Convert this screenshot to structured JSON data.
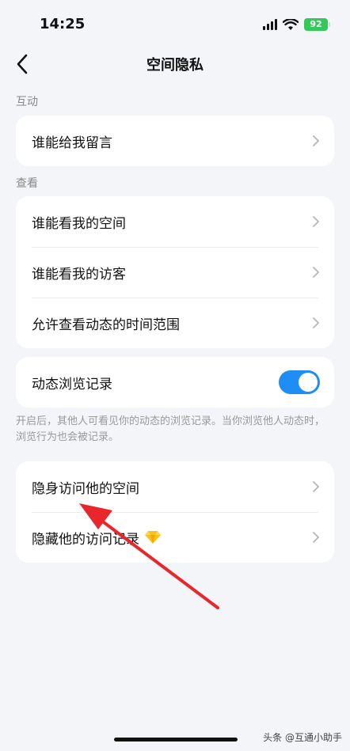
{
  "status_bar": {
    "time": "14:25",
    "battery": "92"
  },
  "nav": {
    "title": "空间隐私"
  },
  "sections": {
    "interaction": {
      "label": "互动",
      "items": [
        {
          "label": "谁能给我留言"
        }
      ]
    },
    "view": {
      "label": "查看",
      "items": [
        {
          "label": "谁能看我的空间"
        },
        {
          "label": "谁能看我的访客"
        },
        {
          "label": "允许查看动态的时间范围"
        }
      ]
    },
    "browse": {
      "toggle_label": "动态浏览记录",
      "toggle_on": true,
      "note": "开启后，其他人可看见你的动态的浏览记录。当你浏览他人动态时，浏览行为也会被记录。"
    },
    "stealth": {
      "items": [
        {
          "label": "隐身访问他的空间"
        },
        {
          "label": "隐藏他的访问记录"
        }
      ]
    }
  },
  "watermark": "头条 @互通小助手",
  "colors": {
    "toggle_on": "#1e8ef5",
    "battery": "#34c759",
    "annotation_arrow": "#e8262b"
  }
}
